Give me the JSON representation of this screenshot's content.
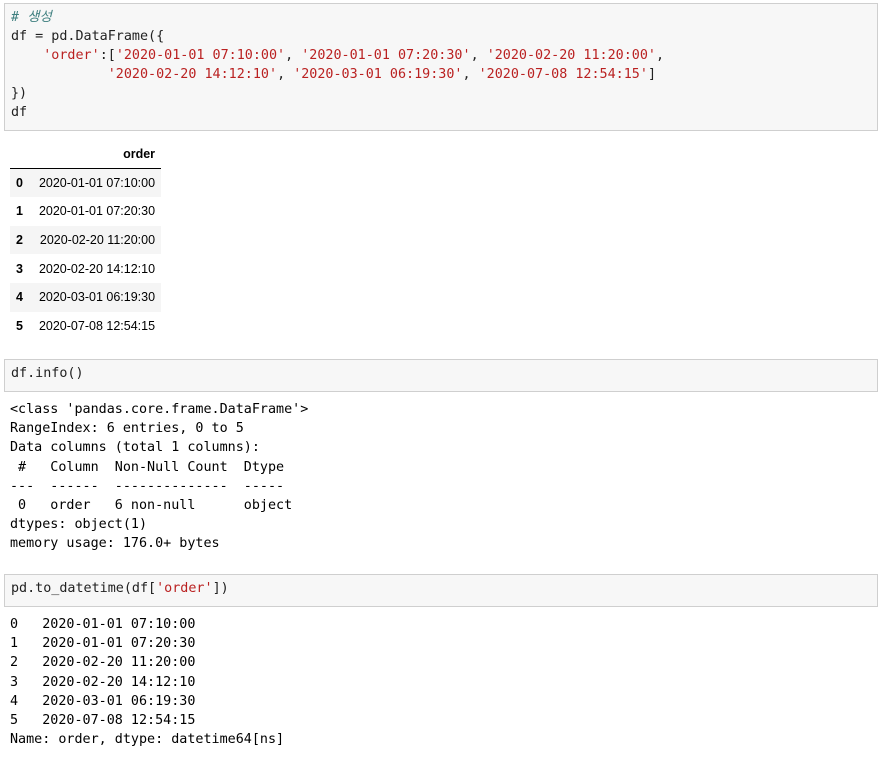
{
  "cell1": {
    "comment": "# 생성",
    "line2": "df = pd.DataFrame({",
    "key": "'order'",
    "sep1": ":[",
    "v1": "'2020-01-01 07:10:00'",
    "v2": "'2020-01-01 07:20:30'",
    "v3": "'2020-02-20 11:20:00'",
    "v4": "'2020-02-20 14:12:10'",
    "v5": "'2020-03-01 06:19:30'",
    "v6": "'2020-07-08 12:54:15'",
    "comma": ", ",
    "close_list": "]",
    "line5": "})",
    "line6": "df"
  },
  "table": {
    "header_index": "",
    "header_col": "order",
    "rows": [
      {
        "index": "0",
        "order": "2020-01-01 07:10:00"
      },
      {
        "index": "1",
        "order": "2020-01-01 07:20:30"
      },
      {
        "index": "2",
        "order": "2020-02-20 11:20:00"
      },
      {
        "index": "3",
        "order": "2020-02-20 14:12:10"
      },
      {
        "index": "4",
        "order": "2020-03-01 06:19:30"
      },
      {
        "index": "5",
        "order": "2020-07-08 12:54:15"
      }
    ]
  },
  "cell2": {
    "code": "df.info()"
  },
  "info_output": [
    "<class 'pandas.core.frame.DataFrame'>",
    "RangeIndex: 6 entries, 0 to 5",
    "Data columns (total 1 columns):",
    " #   Column  Non-Null Count  Dtype ",
    "---  ------  --------------  ----- ",
    " 0   order   6 non-null      object",
    "dtypes: object(1)",
    "memory usage: 176.0+ bytes"
  ],
  "cell3": {
    "prefix": "pd.to_datetime(df[",
    "key": "'order'",
    "suffix": "])"
  },
  "datetime_output": [
    "0   2020-01-01 07:10:00",
    "1   2020-01-01 07:20:30",
    "2   2020-02-20 11:20:00",
    "3   2020-02-20 14:12:10",
    "4   2020-03-01 06:19:30",
    "5   2020-07-08 12:54:15",
    "Name: order, dtype: datetime64[ns]"
  ],
  "colors": {
    "comment": "#408080",
    "string": "#ba2121",
    "cell_bg": "#f7f7f7",
    "cell_border": "#cfcfcf"
  }
}
